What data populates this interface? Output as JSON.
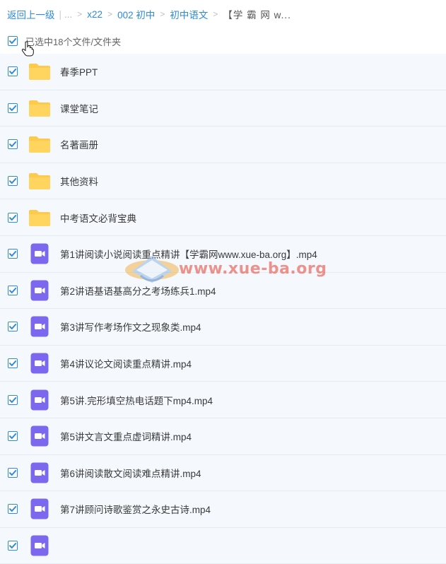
{
  "breadcrumb": {
    "back": "返回上一级",
    "ellipsis": "...",
    "items": [
      "x22",
      "002 初中",
      "初中语文"
    ],
    "current": "【学 霸 网 w..."
  },
  "selection": {
    "count_text": "已选中18个文件/文件夹",
    "checked": true
  },
  "watermark": {
    "text": "www.xue-ba.org"
  },
  "colors": {
    "accent": "#2b8be0",
    "folder": "#ffca4b",
    "video": "#7b68ee",
    "row_bg": "#f5f9fd"
  },
  "files": [
    {
      "name": "春季PPT",
      "type": "folder",
      "icon": "folder-icon"
    },
    {
      "name": "课堂笔记",
      "type": "folder",
      "icon": "folder-icon"
    },
    {
      "name": "名著画册",
      "type": "folder",
      "icon": "folder-icon"
    },
    {
      "name": "其他资料",
      "type": "folder",
      "icon": "folder-icon"
    },
    {
      "name": "中考语文必背宝典",
      "type": "folder",
      "icon": "folder-icon"
    },
    {
      "name": "第1讲阅读小说阅读重点精讲【学霸网www.xue-ba.org】.mp4",
      "type": "video",
      "icon": "video-file-icon"
    },
    {
      "name": "第2讲语基语基高分之考场练兵1.mp4",
      "type": "video",
      "icon": "video-file-icon"
    },
    {
      "name": "第3讲写作考场作文之现象类.mp4",
      "type": "video",
      "icon": "video-file-icon"
    },
    {
      "name": "第4讲议论文阅读重点精讲.mp4",
      "type": "video",
      "icon": "video-file-icon"
    },
    {
      "name": "第5讲.完形填空热电话题下mp4.mp4",
      "type": "video",
      "icon": "video-file-icon"
    },
    {
      "name": "第5讲文言文重点虚词精讲.mp4",
      "type": "video",
      "icon": "video-file-icon"
    },
    {
      "name": "第6讲阅读散文阅读难点精讲.mp4",
      "type": "video",
      "icon": "video-file-icon"
    },
    {
      "name": "第7讲顾问诗歌鉴赏之永史古诗.mp4",
      "type": "video",
      "icon": "video-file-icon"
    },
    {
      "name": "",
      "type": "video",
      "icon": "video-file-icon"
    }
  ]
}
